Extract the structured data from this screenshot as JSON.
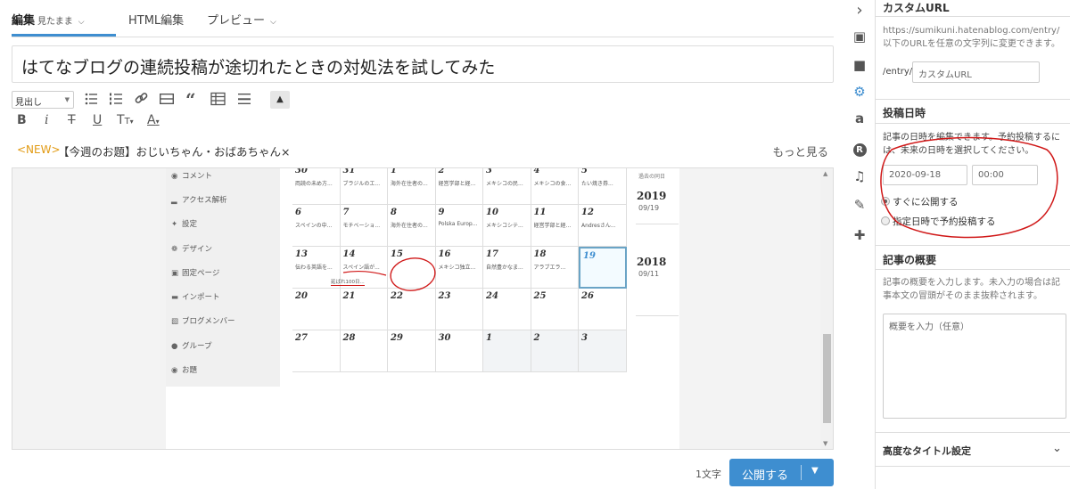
{
  "tabs": {
    "edit": "編集",
    "edit_mode": "見たまま",
    "html": "HTML編集",
    "preview": "プレビュー"
  },
  "title": "はてなブログの連続投稿が途切れたときの対処法を試してみた",
  "toolbar": {
    "heading_select": "見出し",
    "row2": [
      "B",
      "i",
      "T",
      "U",
      "T",
      "A"
    ]
  },
  "notice": {
    "new": "<NEW>",
    "topic": "【今週のお題】おじいちゃん・おばあちゃん×",
    "more": "もっと見る"
  },
  "screenshot": {
    "sidebar": [
      "コメント",
      "アクセス解析",
      "設定",
      "デザイン",
      "固定ページ",
      "インポート",
      "ブログメンバー",
      "グループ",
      "お題"
    ],
    "side_label": "過去の同日",
    "years": [
      {
        "year": "2019",
        "date": "09/19"
      },
      {
        "year": "2018",
        "date": "09/11"
      }
    ],
    "calendar": [
      [
        {
          "d": "30",
          "t": "両読の未め方..."
        },
        {
          "d": "31",
          "t": "ブラジルのエ..."
        },
        {
          "d": "1",
          "t": "海外在住者の..."
        },
        {
          "d": "2",
          "t": "経営学部と経..."
        },
        {
          "d": "3",
          "t": "メキシコの民..."
        },
        {
          "d": "4",
          "t": "メキシコの食..."
        },
        {
          "d": "5",
          "t": "たい焼き券..."
        }
      ],
      [
        {
          "d": "6",
          "t": "スペインの中..."
        },
        {
          "d": "7",
          "t": "モチベーショ..."
        },
        {
          "d": "8",
          "t": "海外在住者の..."
        },
        {
          "d": "9",
          "t": "Polska Europ..."
        },
        {
          "d": "10",
          "t": "メキシコシテ..."
        },
        {
          "d": "11",
          "t": "経営学部と経..."
        },
        {
          "d": "12",
          "t": "Andresさん..."
        }
      ],
      [
        {
          "d": "13",
          "t": "伝わる英語を..."
        },
        {
          "d": "14",
          "t": "スペイン語が..."
        },
        {
          "d": "15",
          "t": ""
        },
        {
          "d": "16",
          "t": "メキシコ独立..."
        },
        {
          "d": "17",
          "t": "自然豊かなま..."
        },
        {
          "d": "18",
          "t": "アラブエラ..."
        },
        {
          "d": "19",
          "t": ""
        }
      ],
      [
        {
          "d": "20",
          "t": ""
        },
        {
          "d": "21",
          "t": ""
        },
        {
          "d": "22",
          "t": ""
        },
        {
          "d": "23",
          "t": ""
        },
        {
          "d": "24",
          "t": ""
        },
        {
          "d": "25",
          "t": ""
        },
        {
          "d": "26",
          "t": ""
        }
      ],
      [
        {
          "d": "27",
          "t": ""
        },
        {
          "d": "28",
          "t": ""
        },
        {
          "d": "29",
          "t": ""
        },
        {
          "d": "30",
          "t": ""
        },
        {
          "d": "1",
          "t": ""
        },
        {
          "d": "2",
          "t": ""
        },
        {
          "d": "3",
          "t": ""
        }
      ]
    ],
    "note14": "延ばれ100日..."
  },
  "footer": {
    "count": "1文字",
    "publish": "公開する"
  },
  "panel": {
    "custom_url": {
      "heading": "カスタムURL",
      "desc": "https://sumikuni.hatenablog.com/entry/以下のURLを任意の文字列に変更できます。",
      "prefix": "/entry/",
      "placeholder": "カスタムURL"
    },
    "post_date": {
      "heading": "投稿日時",
      "desc": "記事の日時を編集できます。予約投稿するには、未来の日時を選択してください。",
      "date": "2020-09-18",
      "time": "00:00",
      "opt_now": "すぐに公開する",
      "opt_schedule": "指定日時で予約投稿する"
    },
    "summary": {
      "heading": "記事の概要",
      "desc": "記事の概要を入力します。未入力の場合は記事本文の冒頭がそのまま抜粋されます。",
      "placeholder": "概要を入力（任意）"
    },
    "advanced": {
      "heading": "高度なタイトル設定"
    }
  },
  "icons": [
    "chevron-right-icon",
    "image-icon",
    "folder-icon",
    "gear-icon",
    "amazon-icon",
    "rakuten-icon",
    "music-icon",
    "brush-icon",
    "plus-icon"
  ],
  "colors": {
    "accent": "#3e8ed0",
    "new_label": "#e29b14",
    "annotation": "#d01818"
  }
}
